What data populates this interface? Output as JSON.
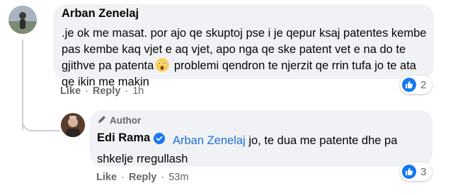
{
  "comment1": {
    "author": "Arban Zenelaj",
    "text_before_emoji": ".je ok me masat. por ajo qe skuptoj pse i je qepur ksaj patentes kembe pas kembe kaq vjet e aq vjet, apo nga qe ske patent vet e na do te gjithve pa patenta",
    "emoji": "astonished-face-emoji",
    "text_after_emoji": " problemi qendron te njerzit qe rrin tufa jo te ata qe ikin me makin",
    "like_label": "Like",
    "reply_label": "Reply",
    "time": "1h",
    "reaction_count": "2",
    "separator": "·"
  },
  "comment2": {
    "author_badge": "Author",
    "author": "Edi Rama",
    "mention": "Arban Zenelaj",
    "text": " jo, te dua me patente dhe pa shkelje rregullash",
    "like_label": "Like",
    "reply_label": "Reply",
    "time": "53m",
    "reaction_count": "3",
    "separator": "·"
  },
  "colors": {
    "bubble": "#f0f2f5",
    "like_blue": "#1877f2",
    "mention": "#216fdb",
    "meta_gray": "#65676b"
  }
}
